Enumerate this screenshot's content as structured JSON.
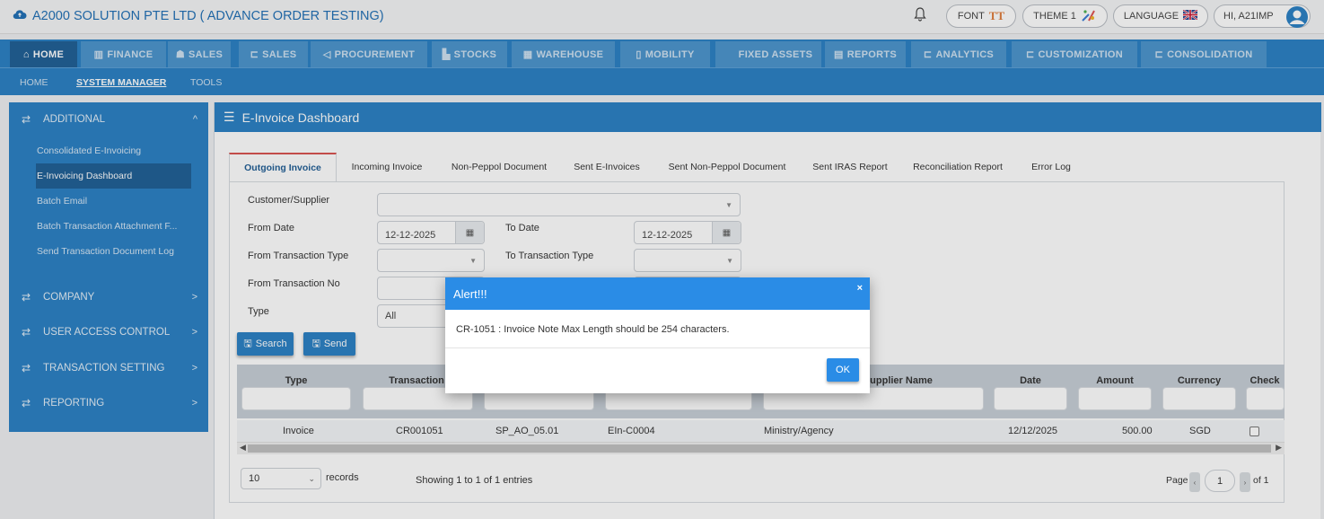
{
  "app": {
    "title": "A2000 SOLUTION PTE LTD ( ADVANCE ORDER TESTING)"
  },
  "topbar": {
    "font_label": "FONT",
    "font_glyph": "TT",
    "theme_label": "THEME 1",
    "language_label": "LANGUAGE",
    "user_label": "HI, A21IMP"
  },
  "main_nav": [
    {
      "label": "HOME",
      "icon": "home-icon"
    },
    {
      "label": "FINANCE",
      "icon": "bank-icon"
    },
    {
      "label": "SALES",
      "icon": "users-icon"
    },
    {
      "label": "SALES",
      "icon": "cart-icon"
    },
    {
      "label": "PROCUREMENT",
      "icon": "bullhorn-icon"
    },
    {
      "label": "STOCKS",
      "icon": "bar-chart-icon"
    },
    {
      "label": "WAREHOUSE",
      "icon": "building-icon"
    },
    {
      "label": "MOBILITY",
      "icon": "mobile-icon"
    },
    {
      "label": "FIXED ASSETS",
      "icon": ""
    },
    {
      "label": "REPORTS",
      "icon": "report-icon"
    },
    {
      "label": "ANALYTICS",
      "icon": "cart-icon"
    },
    {
      "label": "CUSTOMIZATION",
      "icon": "cart-icon"
    },
    {
      "label": "CONSOLIDATION",
      "icon": "cart-icon"
    }
  ],
  "sub_nav": [
    {
      "label": "HOME"
    },
    {
      "label": "SYSTEM MANAGER"
    },
    {
      "label": "TOOLS"
    }
  ],
  "sidebar": {
    "sections": [
      {
        "label": "ADDITIONAL",
        "chevron": "^"
      },
      {
        "label": "COMPANY",
        "chevron": ">"
      },
      {
        "label": "USER ACCESS CONTROL",
        "chevron": ">"
      },
      {
        "label": "TRANSACTION SETTING",
        "chevron": ">"
      },
      {
        "label": "REPORTING",
        "chevron": ">"
      }
    ],
    "items": [
      {
        "label": "Consolidated E-Invoicing"
      },
      {
        "label": "E-Invoicing Dashboard"
      },
      {
        "label": "Batch Email"
      },
      {
        "label": "Batch Transaction Attachment F..."
      },
      {
        "label": "Send Transaction Document Log"
      }
    ]
  },
  "panel": {
    "title": "E-Invoice Dashboard"
  },
  "tabs": [
    {
      "label": "Outgoing Invoice"
    },
    {
      "label": "Incoming Invoice"
    },
    {
      "label": "Non-Peppol Document"
    },
    {
      "label": "Sent E-Invoices"
    },
    {
      "label": "Sent Non-Peppol Document"
    },
    {
      "label": "Sent IRAS Report"
    },
    {
      "label": "Reconciliation Report"
    },
    {
      "label": "Error Log"
    }
  ],
  "form": {
    "customer_supplier_label": "Customer/Supplier",
    "from_date_label": "From Date",
    "from_date_value": "12-12-2025",
    "to_date_label": "To Date",
    "to_date_value": "12-12-2025",
    "from_txn_type_label": "From Transaction Type",
    "to_txn_type_label": "To Transaction Type",
    "from_txn_no_label": "From Transaction No",
    "type_label": "Type",
    "type_value": "All",
    "search_label": "Search",
    "send_label": "Send"
  },
  "grid": {
    "columns": [
      "Type",
      "Transaction",
      "",
      "",
      "upplier Name",
      "Date",
      "Amount",
      "Currency",
      "Check"
    ],
    "row": {
      "type": "Invoice",
      "transaction": "CR001051",
      "ref": "SP_AO_05.01",
      "einvoice": "EIn-C0004",
      "supplier_name": "Ministry/Agency",
      "date": "12/12/2025",
      "amount": "500.00",
      "currency": "SGD",
      "checked": false
    }
  },
  "footer": {
    "page_size": "10",
    "records_label": "records",
    "showing": "Showing 1 to 1 of 1 entries",
    "page_label": "Page",
    "page_value": "1",
    "of_label": "of 1"
  },
  "alert": {
    "title": "Alert!!!",
    "close": "×",
    "message": "CR-1051 : Invoice Note Max Length should be 254 characters.",
    "ok_label": "OK"
  },
  "colors": {
    "primary": "#2a80c4",
    "dark_tab": "#1e5f96",
    "modal_header": "#2a8ce6",
    "active_tab_border": "#d9534f"
  }
}
